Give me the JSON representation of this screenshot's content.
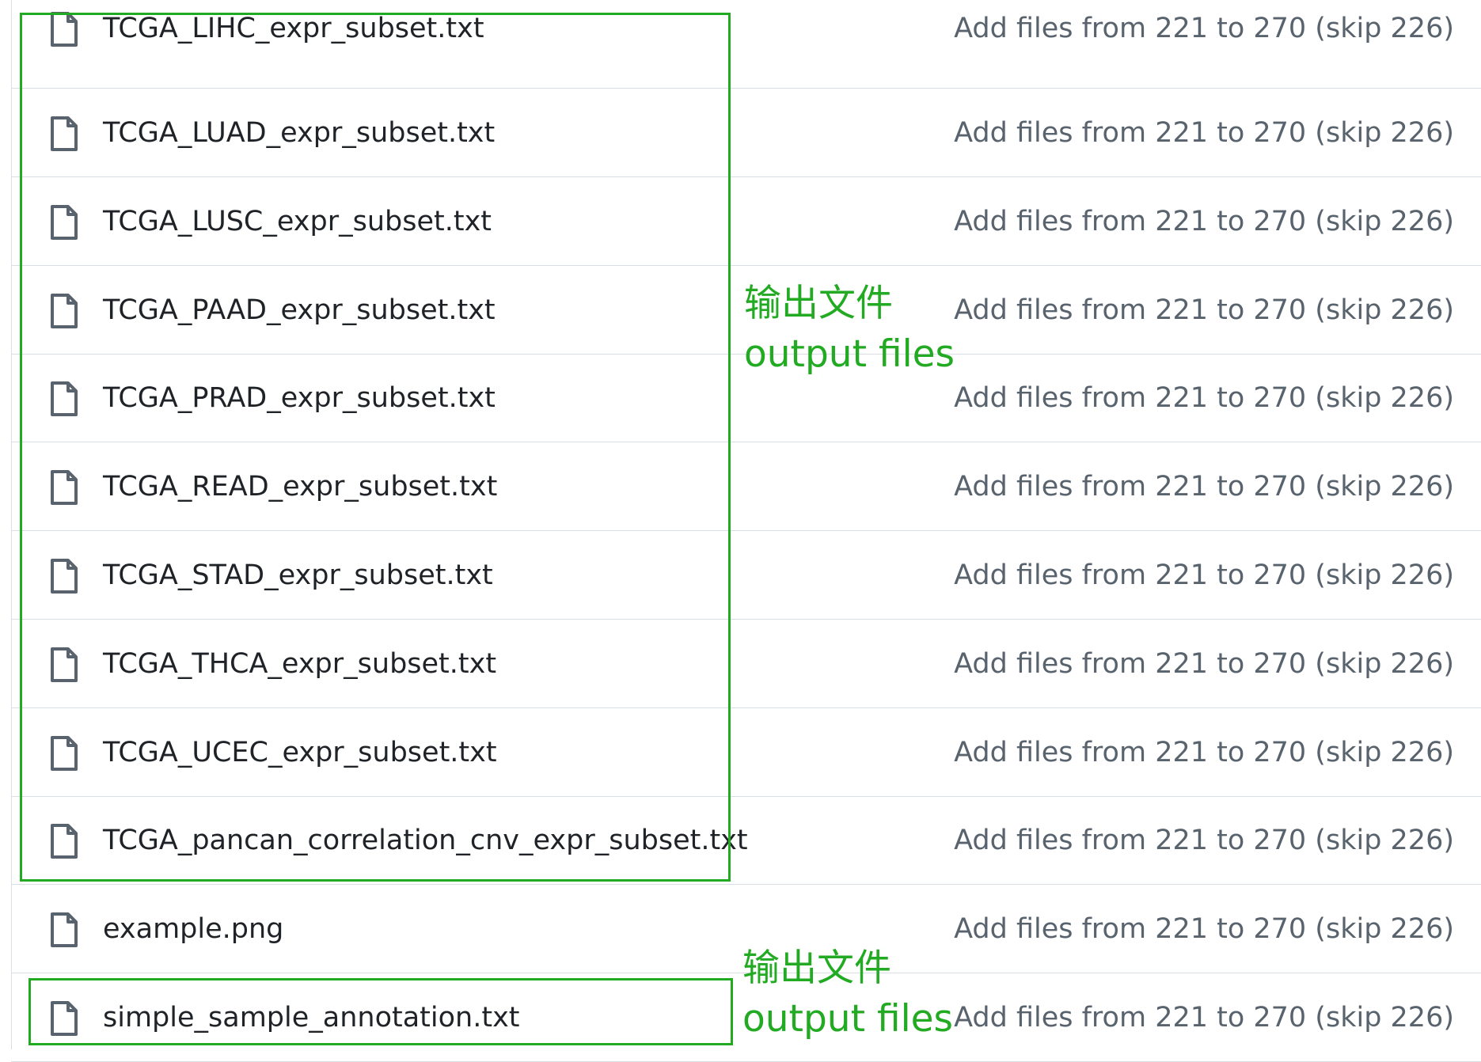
{
  "files": [
    {
      "name": "TCGA_LIHC_expr_subset.txt",
      "commit": "Add files from 221 to 270 (skip 226)"
    },
    {
      "name": "TCGA_LUAD_expr_subset.txt",
      "commit": "Add files from 221 to 270 (skip 226)"
    },
    {
      "name": "TCGA_LUSC_expr_subset.txt",
      "commit": "Add files from 221 to 270 (skip 226)"
    },
    {
      "name": "TCGA_PAAD_expr_subset.txt",
      "commit": "Add files from 221 to 270 (skip 226)"
    },
    {
      "name": "TCGA_PRAD_expr_subset.txt",
      "commit": "Add files from 221 to 270 (skip 226)"
    },
    {
      "name": "TCGA_READ_expr_subset.txt",
      "commit": "Add files from 221 to 270 (skip 226)"
    },
    {
      "name": "TCGA_STAD_expr_subset.txt",
      "commit": "Add files from 221 to 270 (skip 226)"
    },
    {
      "name": "TCGA_THCA_expr_subset.txt",
      "commit": "Add files from 221 to 270 (skip 226)"
    },
    {
      "name": "TCGA_UCEC_expr_subset.txt",
      "commit": "Add files from 221 to 270 (skip 226)"
    },
    {
      "name": "TCGA_pancan_correlation_cnv_expr_subset.txt",
      "commit": "Add files from 221 to 270 (skip 226)"
    },
    {
      "name": "example.png",
      "commit": "Add files from 221 to 270 (skip 226)"
    },
    {
      "name": "simple_sample_annotation.txt",
      "commit": "Add files from 221 to 270 (skip 226)"
    }
  ],
  "annotations": [
    {
      "line1": "输出文件",
      "line2": "output files"
    },
    {
      "line1": "输出文件",
      "line2": "output files"
    }
  ],
  "icons": {
    "file": "file-icon"
  },
  "colors": {
    "annotation": "#22aa22",
    "file_name": "#1f2328",
    "commit_message": "#59636e",
    "icon": "#59636e",
    "divider": "#d8dee4"
  }
}
